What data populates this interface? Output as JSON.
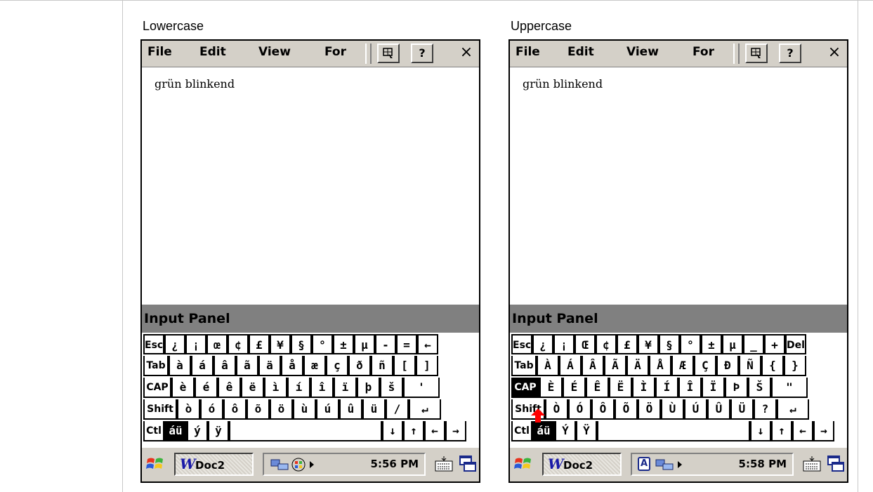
{
  "panels": [
    {
      "caption": "Lowercase",
      "menu": [
        "File",
        "Edit",
        "View",
        "For"
      ],
      "help_label": "?",
      "close_label": "×",
      "document_text": "grün blinkend",
      "input_panel_title": "Input Panel",
      "rows": [
        [
          "Esc",
          "¿",
          "¡",
          "œ",
          "¢",
          "£",
          "¥",
          "§",
          "°",
          "±",
          "µ",
          "-",
          "=",
          "←"
        ],
        [
          "Tab",
          "à",
          "á",
          "â",
          "ã",
          "ä",
          "å",
          "æ",
          "ç",
          "ð",
          "ñ",
          "[",
          "]"
        ],
        [
          "CAP",
          "è",
          "é",
          "ê",
          "ë",
          "ì",
          "í",
          "î",
          "ï",
          "þ",
          "š",
          "'"
        ],
        [
          "Shift",
          "ò",
          "ó",
          "ô",
          "õ",
          "ö",
          "ù",
          "ú",
          "û",
          "ü",
          "/",
          "↵"
        ],
        [
          "Ctl",
          "áü",
          "ý",
          "ÿ",
          "",
          "↓",
          "↑",
          "←",
          "→"
        ]
      ],
      "taskbar": {
        "app_label": "Doc2",
        "time": "5:56 PM"
      }
    },
    {
      "caption": "Uppercase",
      "menu": [
        "File",
        "Edit",
        "View",
        "For"
      ],
      "help_label": "?",
      "close_label": "×",
      "document_text": "grün blinkend",
      "input_panel_title": "Input Panel",
      "rows": [
        [
          "Esc",
          "¿",
          "¡",
          "Œ",
          "¢",
          "£",
          "¥",
          "§",
          "°",
          "±",
          "µ",
          "_",
          "+",
          "Del"
        ],
        [
          "Tab",
          "À",
          "Á",
          "Â",
          "Ã",
          "Ä",
          "Å",
          "Æ",
          "Ç",
          "Đ",
          "Ñ",
          "{",
          "}"
        ],
        [
          "CAP",
          "È",
          "É",
          "Ê",
          "Ë",
          "Ì",
          "Í",
          "Î",
          "Ï",
          "Þ",
          "Š",
          "\""
        ],
        [
          "Shift",
          "Ò",
          "Ó",
          "Ô",
          "Õ",
          "Ö",
          "Ù",
          "Ú",
          "Û",
          "Ü",
          "?",
          "↵"
        ],
        [
          "Ctl",
          "áü",
          "Ý",
          "Ÿ",
          "",
          "↓",
          "↑",
          "←",
          "→"
        ]
      ],
      "taskbar": {
        "app_label": "Doc2",
        "tray_badge": "A",
        "time": "5:58 PM"
      }
    }
  ],
  "colors": {
    "menubar": "#d4d0c8",
    "input_panel_header": "#808080",
    "arrow_marker": "#ff0000",
    "doc_icon": "#1a1aa8"
  }
}
